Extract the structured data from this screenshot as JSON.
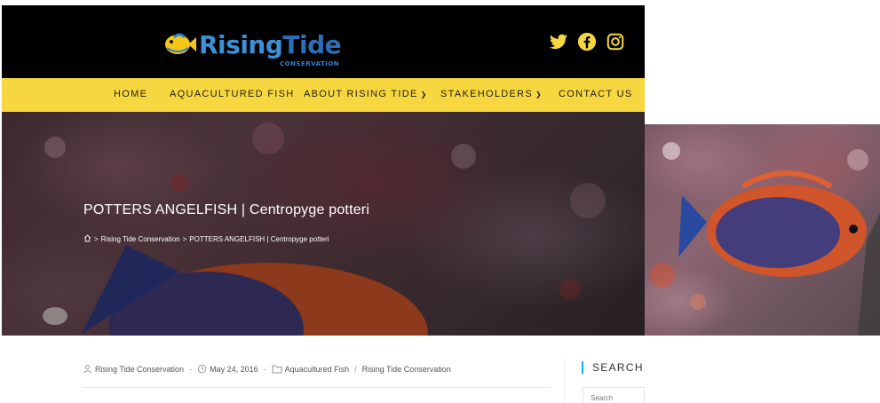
{
  "brand": {
    "name_part1": "Rising",
    "name_part2": "Tide",
    "subtitle": "CONSERVATION"
  },
  "social": [
    "twitter-icon",
    "facebook-icon",
    "instagram-icon"
  ],
  "nav": {
    "items": [
      {
        "label": "HOME",
        "dropdown": false
      },
      {
        "label": "AQUACULTURED FISH",
        "dropdown": false
      },
      {
        "label": "ABOUT RISING TIDE",
        "dropdown": true
      },
      {
        "label": "STAKEHOLDERS",
        "dropdown": true
      },
      {
        "label": "CONTACT US",
        "dropdown": false
      }
    ]
  },
  "hero": {
    "title": "POTTERS ANGELFISH | Centropyge potteri",
    "breadcrumb": {
      "home": "Rising Tide Conservation",
      "separator": ">",
      "current": "POTTERS ANGELFISH | Centropyge potteri"
    }
  },
  "post_meta": {
    "author": "Rising Tide Conservation",
    "date": "May 24, 2016",
    "category_1": "Aquacultured Fish",
    "category_sep": "/",
    "category_2": "Rising Tide Conservation",
    "dot": "-"
  },
  "sidebar": {
    "search_heading": "SEARCH",
    "search_placeholder": "Search"
  },
  "colors": {
    "header_bg": "#000000",
    "nav_bg": "#f7d73f",
    "accent": "#13aff0",
    "logo_blue": "#3d8fd6",
    "fish_orange": "#e0552a",
    "fish_blue": "#2a3a8a"
  }
}
